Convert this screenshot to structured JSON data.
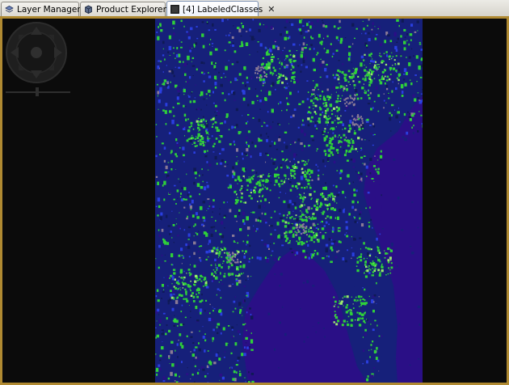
{
  "tabs": [
    {
      "label": "Layer Manager",
      "icon": "layers-icon",
      "active": false
    },
    {
      "label": "Product Explorer",
      "icon": "product-explorer-icon",
      "active": false
    },
    {
      "label": "[4] LabeledClasses",
      "icon": "image-view-icon",
      "active": true
    }
  ],
  "close_glyph": "✕",
  "colors": {
    "frame": "#b08a32",
    "background": "#0b0b0b",
    "water": "#2a0f86",
    "land": "#16207a",
    "vegetation": "#2fd03a",
    "urban": "#8a7a95",
    "accent_blue": "#2a3fe0"
  },
  "map_view": {
    "content": "labeled-classes-raster"
  }
}
